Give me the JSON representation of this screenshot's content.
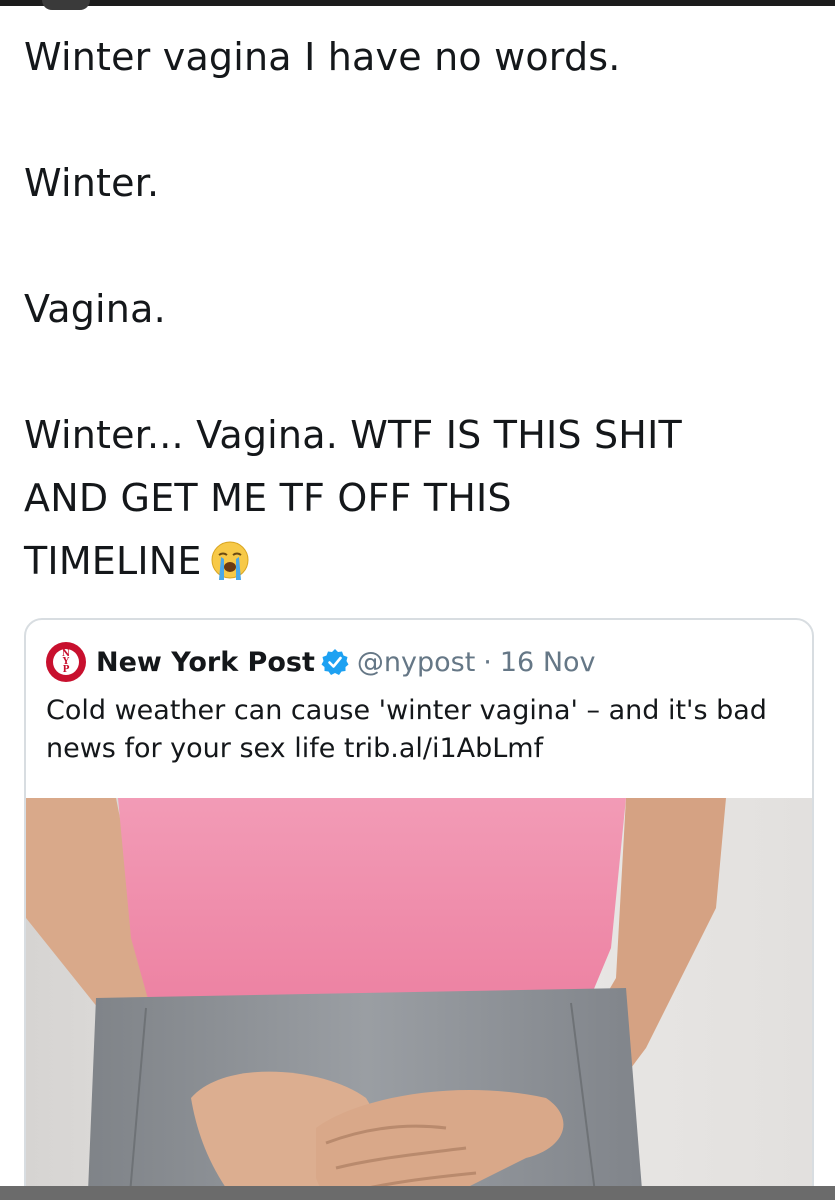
{
  "tweet": {
    "paragraphs": [
      "Winter vagina I have no words.",
      "Winter.",
      "Vagina.",
      "Winter... Vagina. WTF IS THIS SHIT\nAND GET ME TF OFF THIS\nTIMELINE"
    ],
    "trailing_emoji": "loudly-crying-face-icon"
  },
  "quoted_tweet": {
    "author_name": "New York Post",
    "verified": true,
    "handle": "@nypost",
    "separator": "·",
    "date": "16 Nov",
    "text": "Cold weather can cause 'winter vagina' – and it's bad news for your sex life trib.al/i1AbLmf",
    "avatar_logo_text": "NEW YORK POST",
    "image": "woman-pink-shirt-hands-clasped-photo"
  },
  "colors": {
    "text": "#14171a",
    "secondary_text": "#657786",
    "verified_badge": "#1da1f2",
    "nyp_red": "#c8102e",
    "card_border": "#d8dde1",
    "shirt_pink": "#f08aa8",
    "pants_gray": "#8c8f94"
  }
}
